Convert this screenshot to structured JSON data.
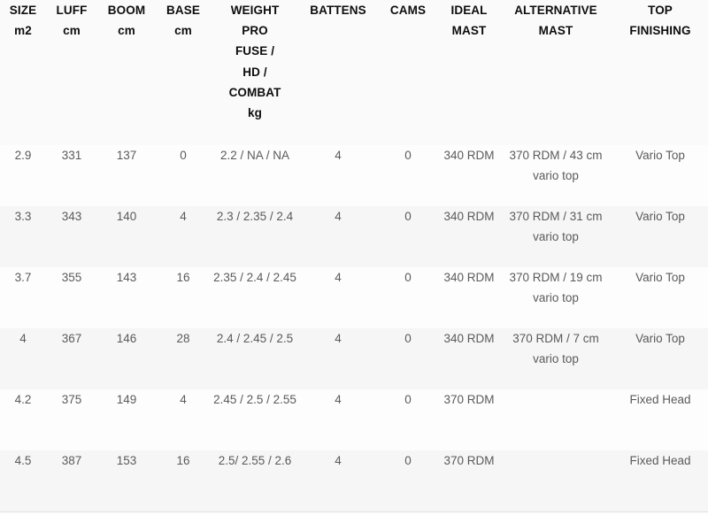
{
  "table": {
    "columns": [
      {
        "key": "size",
        "lines": [
          "SIZE",
          "m2"
        ]
      },
      {
        "key": "luff",
        "lines": [
          "LUFF",
          "cm"
        ]
      },
      {
        "key": "boom",
        "lines": [
          "BOOM",
          "cm"
        ]
      },
      {
        "key": "base",
        "lines": [
          "BASE",
          "cm"
        ]
      },
      {
        "key": "weight",
        "lines": [
          "WEIGHT",
          "PRO",
          "FUSE /",
          "HD /",
          "COMBAT",
          "kg"
        ]
      },
      {
        "key": "battens",
        "lines": [
          "BATTENS"
        ]
      },
      {
        "key": "cams",
        "lines": [
          "CAMS"
        ]
      },
      {
        "key": "ideal_mast",
        "lines": [
          "IDEAL",
          "MAST"
        ]
      },
      {
        "key": "alternative_mast",
        "lines": [
          "ALTERNATIVE",
          "MAST"
        ]
      },
      {
        "key": "top_finishing",
        "lines": [
          "TOP",
          "FINISHING"
        ]
      }
    ],
    "rows": [
      {
        "size": "2.9",
        "luff": "331",
        "boom": "137",
        "base": "0",
        "weight": "2.2 / NA / NA",
        "battens": "4",
        "cams": "0",
        "ideal_mast": "340 RDM",
        "alternative_mast": "370 RDM / 43 cm vario top",
        "top_finishing": "Vario Top"
      },
      {
        "size": "3.3",
        "luff": "343",
        "boom": "140",
        "base": "4",
        "weight": "2.3 / 2.35 / 2.4",
        "battens": "4",
        "cams": "0",
        "ideal_mast": "340 RDM",
        "alternative_mast": "370 RDM / 31 cm vario top",
        "top_finishing": "Vario Top"
      },
      {
        "size": "3.7",
        "luff": "355",
        "boom": "143",
        "base": "16",
        "weight": "2.35 / 2.4 / 2.45",
        "battens": "4",
        "cams": "0",
        "ideal_mast": "340 RDM",
        "alternative_mast": "370 RDM / 19 cm vario top",
        "top_finishing": "Vario Top"
      },
      {
        "size": "4",
        "luff": "367",
        "boom": "146",
        "base": "28",
        "weight": "2.4 / 2.45 / 2.5",
        "battens": "4",
        "cams": "0",
        "ideal_mast": "340 RDM",
        "alternative_mast": "370 RDM / 7 cm vario top",
        "top_finishing": "Vario Top"
      },
      {
        "size": "4.2",
        "luff": "375",
        "boom": "149",
        "base": "4",
        "weight": "2.45 / 2.5 / 2.55",
        "battens": "4",
        "cams": "0",
        "ideal_mast": "370 RDM",
        "alternative_mast": "",
        "top_finishing": "Fixed Head"
      },
      {
        "size": "4.5",
        "luff": "387",
        "boom": "153",
        "base": "16",
        "weight": "2.5/ 2.55 / 2.6",
        "battens": "4",
        "cams": "0",
        "ideal_mast": "370 RDM",
        "alternative_mast": "",
        "top_finishing": "Fixed Head"
      }
    ]
  },
  "colors": {
    "header_text": "#0d0d0d",
    "body_text": "#5a5a5a",
    "row_stripe": "#f6f6f6",
    "row_base": "#fdfdfd",
    "border": "#e6e6e6"
  }
}
